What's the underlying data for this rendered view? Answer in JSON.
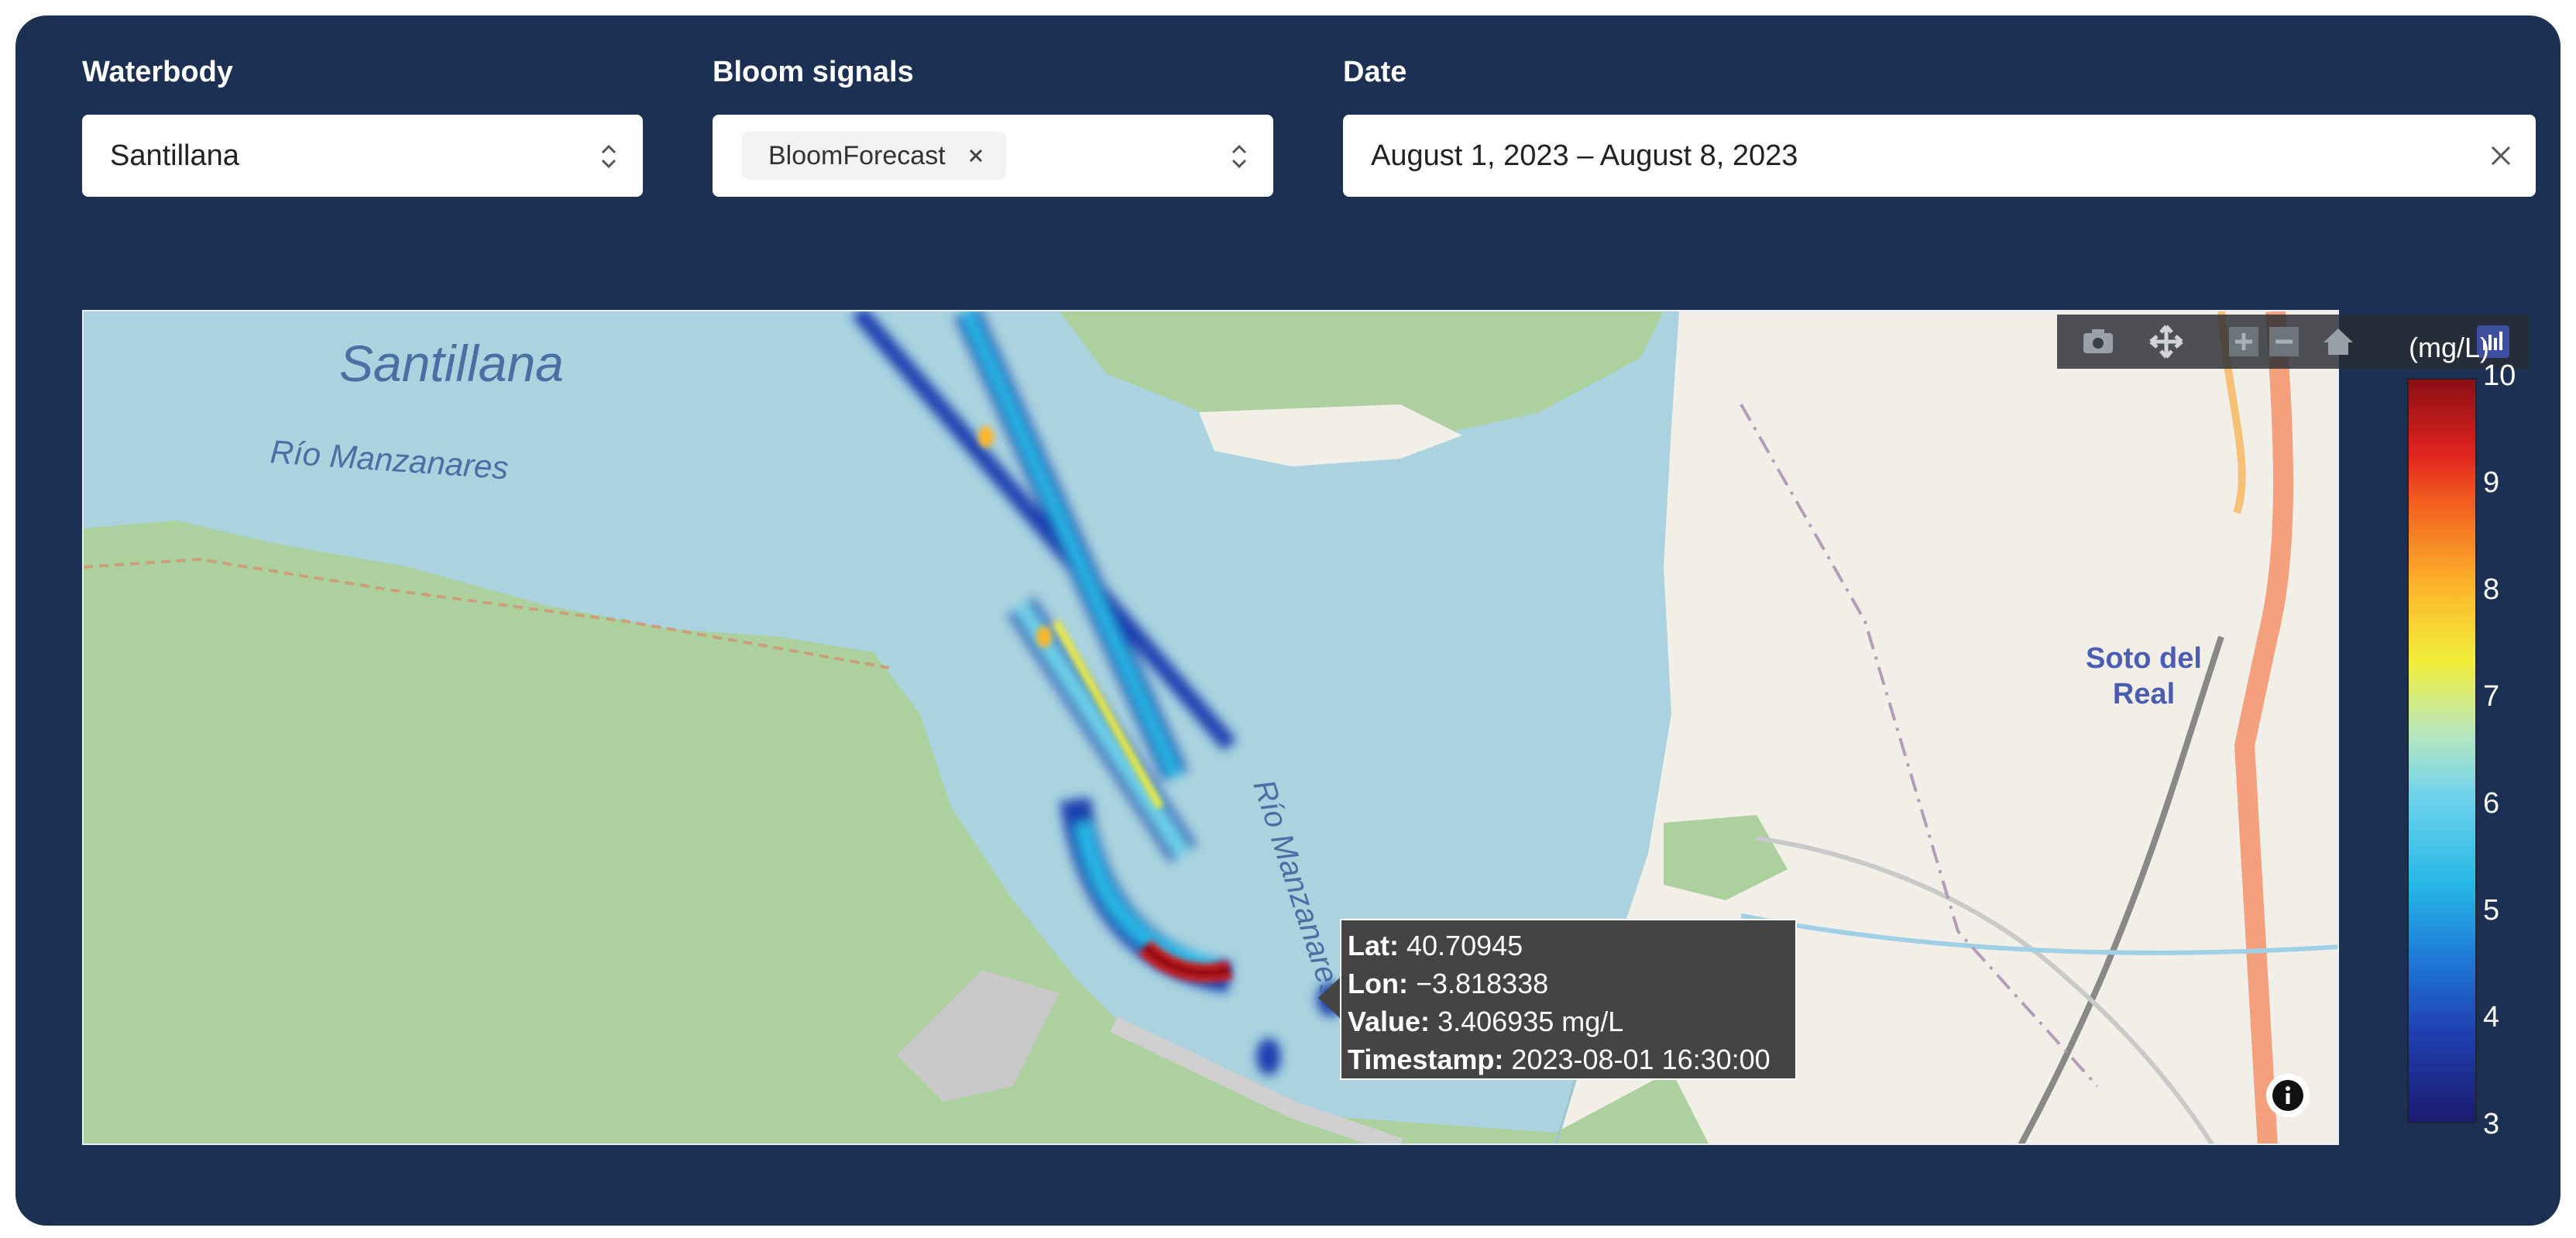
{
  "filters": {
    "waterbody": {
      "label": "Waterbody",
      "value": "Santillana"
    },
    "bloom_signals": {
      "label": "Bloom signals",
      "chips": [
        "BloomForecast"
      ]
    },
    "date": {
      "label": "Date",
      "value": "August 1, 2023 – August 8, 2023"
    }
  },
  "map": {
    "place_labels": {
      "reservoir": "Santillana",
      "river_west": "Río Manzanares",
      "river_center": "Río Manzanares",
      "town_line1": "Soto del",
      "town_line2": "Real"
    },
    "colors": {
      "water": "#aad3df",
      "forest": "#add19e",
      "land": "#f2efe9",
      "panel": "#1b3052"
    }
  },
  "modebar": {
    "icons": [
      "camera-icon",
      "pan-icon",
      "zoom-in-icon",
      "zoom-out-icon",
      "home-icon",
      "plotly-logo-icon"
    ]
  },
  "colorbar": {
    "unit": "(mg/L)",
    "ticks": [
      "10",
      "9",
      "8",
      "7",
      "6",
      "5",
      "4",
      "3"
    ],
    "range": [
      3,
      10
    ],
    "colorscale": "jet"
  },
  "tooltip": {
    "lat_key": "Lat:",
    "lat_val": "40.70945",
    "lon_key": "Lon:",
    "lon_val": "−3.818338",
    "value_key": "Value:",
    "value_val": "3.406935 mg/L",
    "ts_key": "Timestamp:",
    "ts_val": "2023-08-01 16:30:00"
  }
}
